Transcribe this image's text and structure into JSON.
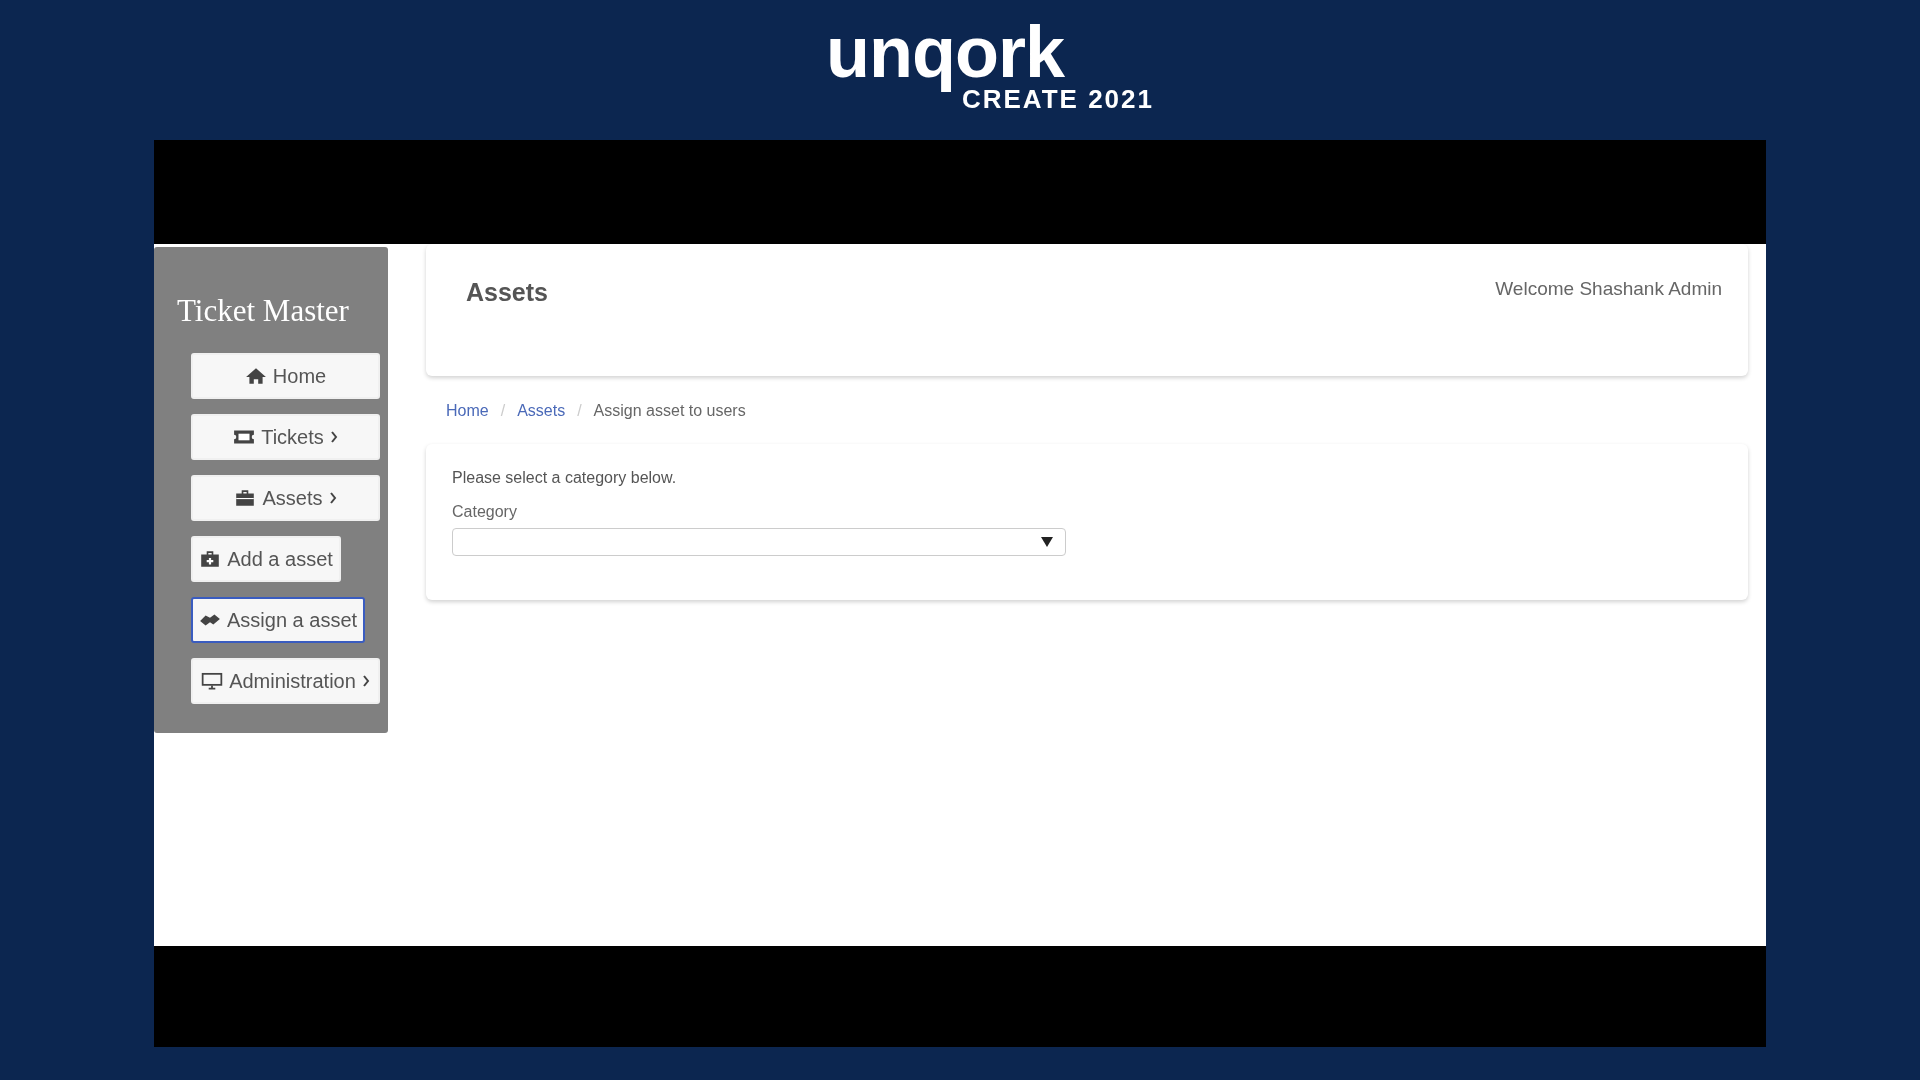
{
  "banner": {
    "logo": "unqork",
    "event": "CREATE 2021"
  },
  "sidebar": {
    "title": "Ticket Master",
    "items": [
      {
        "label": "Home",
        "kind": "main",
        "expandable": false,
        "selected": false
      },
      {
        "label": "Tickets",
        "kind": "main",
        "expandable": true,
        "selected": false
      },
      {
        "label": "Assets",
        "kind": "main",
        "expandable": true,
        "selected": false
      },
      {
        "label": "Add a asset",
        "kind": "sub",
        "expandable": false,
        "selected": false
      },
      {
        "label": "Assign a asset",
        "kind": "sub",
        "expandable": false,
        "selected": true
      },
      {
        "label": "Administration",
        "kind": "main",
        "expandable": true,
        "selected": false
      }
    ]
  },
  "header": {
    "title": "Assets",
    "welcome": "Welcome Shashank Admin"
  },
  "breadcrumb": {
    "separators": [
      "/",
      "/"
    ],
    "items": [
      {
        "label": "Home",
        "link": true
      },
      {
        "label": "Assets",
        "link": true
      },
      {
        "label": "Assign asset to users",
        "link": false
      }
    ]
  },
  "form": {
    "instruction": "Please select a category below.",
    "fields": [
      {
        "label": "Category",
        "kind": "select"
      }
    ]
  }
}
